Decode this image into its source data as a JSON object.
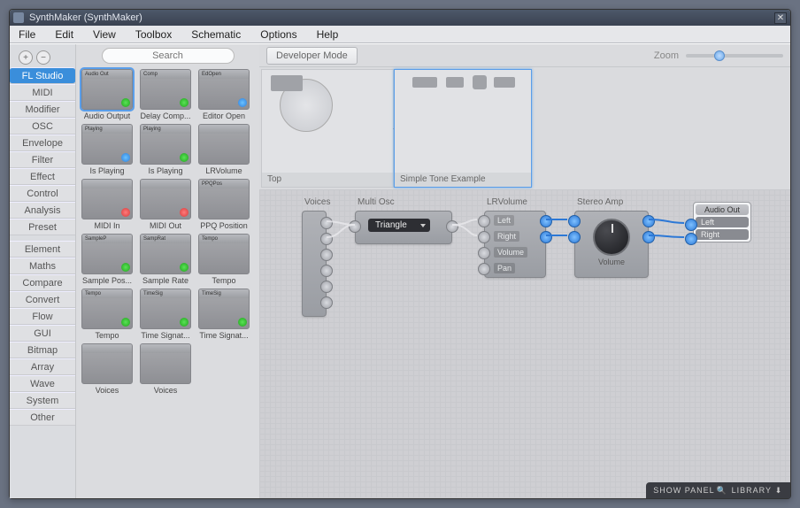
{
  "title": "SynthMaker (SynthMaker)",
  "menu": [
    "File",
    "Edit",
    "View",
    "Toolbox",
    "Schematic",
    "Options",
    "Help"
  ],
  "categories_top": [
    "FL Studio",
    "MIDI",
    "Modifier",
    "OSC",
    "Envelope",
    "Filter",
    "Effect",
    "Control",
    "Analysis",
    "Preset"
  ],
  "categories_bottom": [
    "Element",
    "Maths",
    "Compare",
    "Convert",
    "Flow",
    "GUI",
    "Bitmap",
    "Array",
    "Wave",
    "System",
    "Other"
  ],
  "active_category": "FL Studio",
  "search_placeholder": "Search",
  "dev_mode": "Developer Mode",
  "zoom_label": "Zoom",
  "nav": {
    "top": "Top",
    "current": "Simple Tone Example"
  },
  "modules": [
    {
      "label": "Audio Output",
      "hdr": "Audio Out",
      "sel": true,
      "dot": "g"
    },
    {
      "label": "Delay Comp...",
      "hdr": "Comp",
      "dot": "g"
    },
    {
      "label": "Editor Open",
      "hdr": "EdOpen",
      "dot": "b"
    },
    {
      "label": "Is Playing",
      "hdr": "Playing",
      "dot": "b"
    },
    {
      "label": "Is Playing",
      "hdr": "Playing",
      "dot": "g"
    },
    {
      "label": "LRVolume",
      "hdr": ""
    },
    {
      "label": "MIDI In",
      "hdr": "",
      "dot": "r"
    },
    {
      "label": "MIDI Out",
      "hdr": "",
      "dot": "r"
    },
    {
      "label": "PPQ Position",
      "hdr": "PPQPos"
    },
    {
      "label": "Sample Pos...",
      "hdr": "SampleP",
      "dot": "g"
    },
    {
      "label": "Sample Rate",
      "hdr": "SampRat",
      "dot": "g"
    },
    {
      "label": "Tempo",
      "hdr": "Tempo"
    },
    {
      "label": "Tempo",
      "hdr": "Tempo",
      "dot": "g"
    },
    {
      "label": "Time Signat...",
      "hdr": "TimeSig",
      "dot": "g"
    },
    {
      "label": "Time Signat...",
      "hdr": "TimeSig",
      "dot": "g"
    },
    {
      "label": "Voices",
      "hdr": ""
    },
    {
      "label": "Voices",
      "hdr": ""
    }
  ],
  "canvas_nodes": {
    "voices": "Voices",
    "multi_osc": "Multi Osc",
    "osc_wave": "Triangle",
    "lrvolume": "LRVolume",
    "lr_ports": [
      "Left",
      "Right",
      "Volume",
      "Pan"
    ],
    "stereo_amp": "Stereo Amp",
    "knob": "Volume",
    "audio_out": "Audio Out",
    "ao_rows": [
      "Left",
      "Right"
    ]
  },
  "bottom": {
    "show_panel": "SHOW PANEL",
    "library": "LIBRARY"
  }
}
